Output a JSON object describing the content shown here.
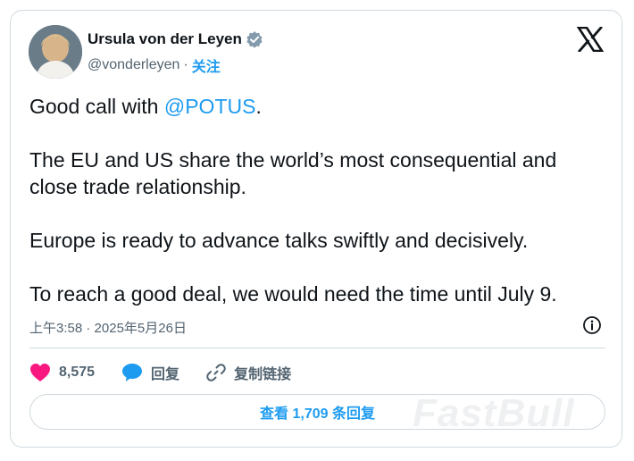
{
  "author": {
    "name": "Ursula von der Leyen",
    "handle": "@vonderleyen",
    "separator": "·",
    "follow_label": "关注"
  },
  "tweet": {
    "line1_prefix": "Good call with ",
    "line1_mention": "@POTUS",
    "line1_suffix": ".",
    "paragraph2": "The EU and US share the world’s most consequential and close trade relationship.",
    "paragraph3": "Europe is ready to advance talks swiftly and decisively.",
    "paragraph4": "To reach a good deal, we would need the time until July 9."
  },
  "meta": {
    "time": "上午3:58",
    "separator": "·",
    "date": "2025年5月26日"
  },
  "actions": {
    "likes": "8,575",
    "reply_label": "回复",
    "copy_link_label": "复制链接"
  },
  "replies_button": "查看 1,709 条回复",
  "watermark": "FastBull",
  "colors": {
    "accent": "#1d9bf0",
    "like": "#f91880",
    "text": "#0f1419",
    "muted": "#536471",
    "border": "#cfd9de"
  },
  "icons": {
    "verified": "verified-badge-icon",
    "brand": "x-logo-icon",
    "info": "info-icon",
    "like": "heart-icon",
    "reply": "speech-bubble-icon",
    "link": "link-icon"
  }
}
